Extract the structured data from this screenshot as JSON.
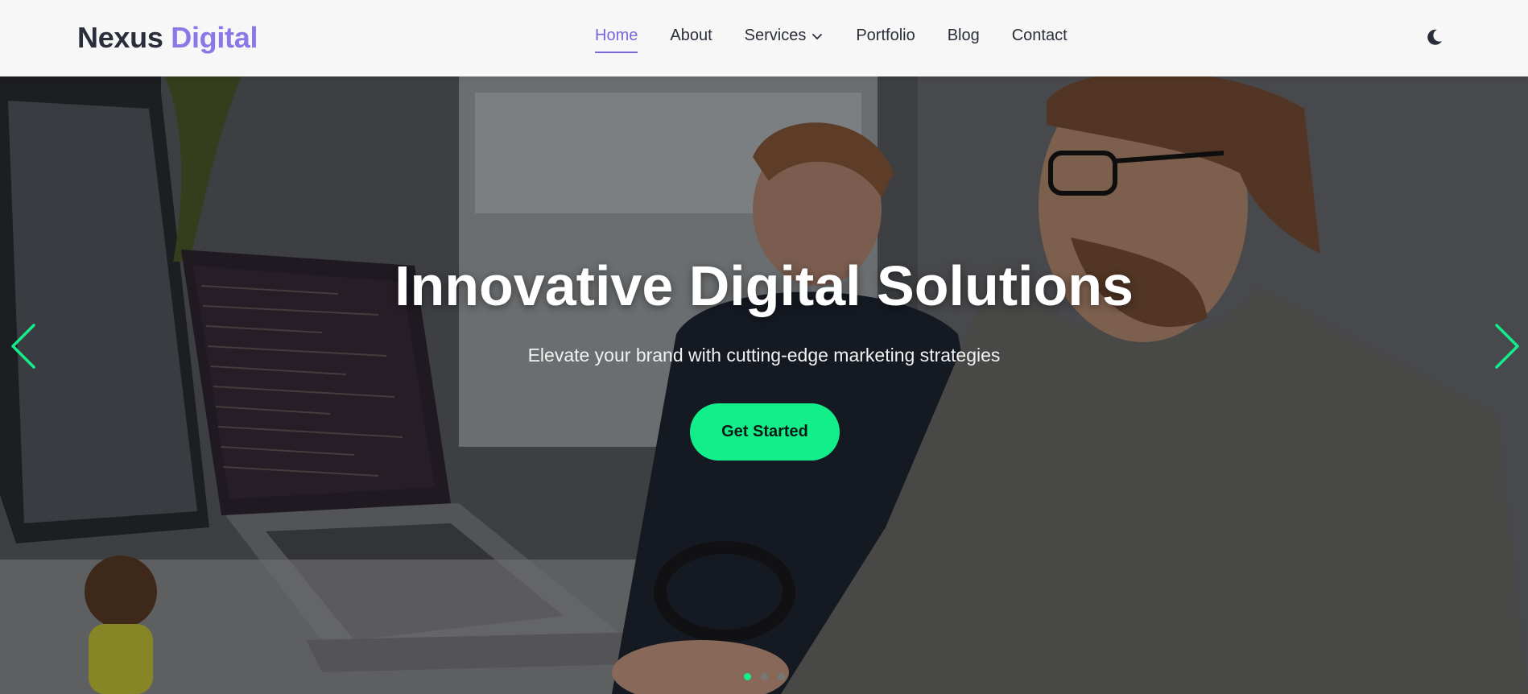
{
  "brand": {
    "part1": "Nexus",
    "part2": "Digital"
  },
  "nav": {
    "items": [
      {
        "label": "Home",
        "active": true
      },
      {
        "label": "About",
        "active": false
      },
      {
        "label": "Services",
        "active": false,
        "has_dropdown": true
      },
      {
        "label": "Portfolio",
        "active": false
      },
      {
        "label": "Blog",
        "active": false
      },
      {
        "label": "Contact",
        "active": false
      }
    ],
    "theme_toggle_icon": "moon-icon"
  },
  "hero": {
    "title": "Innovative Digital Solutions",
    "subtitle": "Elevate your brand with cutting-edge marketing strategies",
    "cta_label": "Get Started",
    "slides_count": 3,
    "active_slide": 1,
    "prev_icon": "chevron-left-icon",
    "next_icon": "chevron-right-icon"
  },
  "colors": {
    "accent": "#8a78e6",
    "nav_active": "#7b66d9",
    "cta": "#12ee8a",
    "text_dark": "#2a2d3a"
  }
}
